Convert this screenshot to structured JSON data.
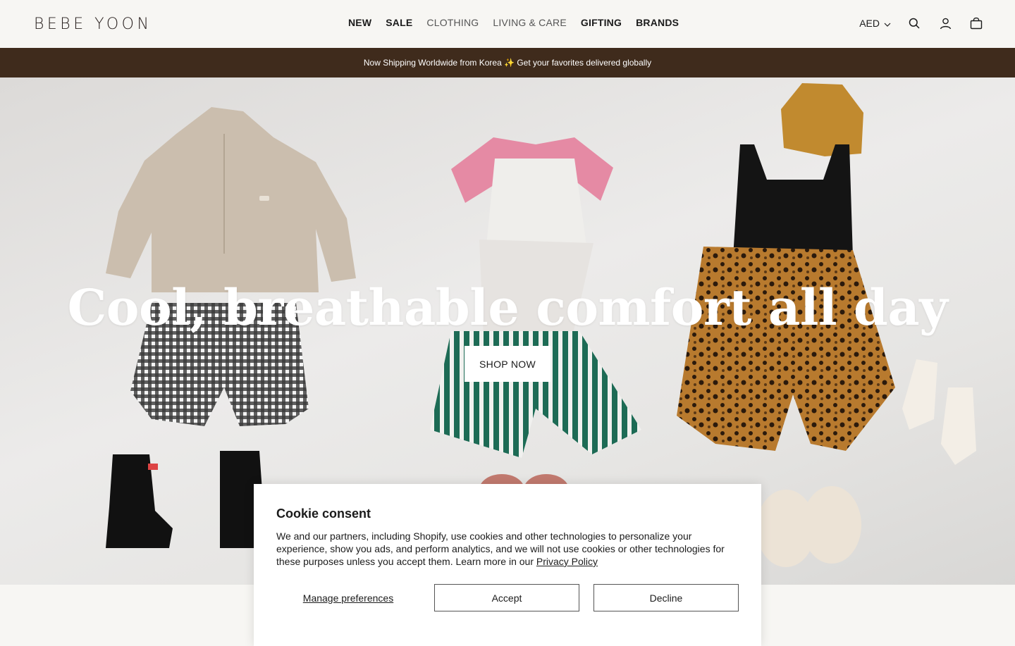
{
  "header": {
    "logo": "BEBE YOON",
    "nav": [
      {
        "label": "NEW"
      },
      {
        "label": "SALE"
      },
      {
        "label": "CLOTHING"
      },
      {
        "label": "LIVING & CARE"
      },
      {
        "label": "GIFTING"
      },
      {
        "label": "BRANDS"
      }
    ],
    "currency": "AED",
    "icons": [
      "search-icon",
      "account-icon",
      "cart-icon"
    ]
  },
  "announcement": {
    "text": "Now Shipping Worldwide from Korea ✨ Get your favorites delivered globally"
  },
  "hero": {
    "title": "Cool, breathable comfort all day",
    "button_label": "SHOP NOW"
  },
  "cookie": {
    "title": "Cookie consent",
    "body": "We and our partners, including Shopify, use cookies and other technologies to personalize your experience, show you ads, and perform analytics, and we will not use cookies or other technologies for these purposes unless you accept them. Learn more in our ",
    "link": "Privacy Policy",
    "manage_label": "Manage preferences",
    "accept_label": "Accept",
    "decline_label": "Decline"
  },
  "colors": {
    "announcement_bg": "#3f2b1c",
    "page_bg": "#f7f6f3",
    "text": "#1b1b1b"
  }
}
